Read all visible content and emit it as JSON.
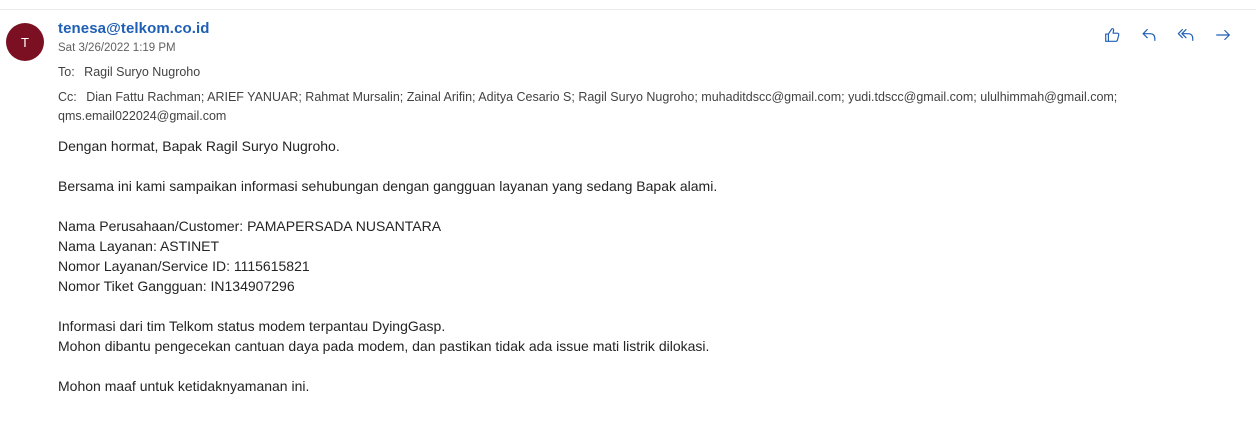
{
  "email": {
    "avatar_initial": "T",
    "sender": "tenesa@telkom.co.id",
    "date": "Sat 3/26/2022 1:19 PM",
    "to_label": "To:",
    "to": "Ragil Suryo Nugroho",
    "cc_label": "Cc:",
    "cc": "Dian Fattu Rachman; ARIEF YANUAR; Rahmat Mursalin; Zainal Arifin; Aditya Cesario S; Ragil Suryo Nugroho; muhaditdscc@gmail.com; yudi.tdscc@gmail.com; ululhimmah@gmail.com; qms.email022024@gmail.com"
  },
  "actions": [
    {
      "icon": "thumbs-up-icon"
    },
    {
      "icon": "reply-icon"
    },
    {
      "icon": "reply-all-icon"
    },
    {
      "icon": "forward-icon"
    }
  ],
  "body": {
    "greeting": "Dengan hormat, Bapak Ragil Suryo Nugroho.",
    "intro": "Bersama ini kami sampaikan informasi sehubungan dengan gangguan layanan yang sedang Bapak alami.",
    "company": "Nama Perusahaan/Customer: PAMAPERSADA NUSANTARA",
    "service_name": "Nama Layanan: ASTINET",
    "service_id": "Nomor Layanan/Service ID: 1115615821",
    "ticket": "Nomor Tiket Gangguan: IN134907296",
    "info_1": "Informasi dari tim Telkom status modem terpantau DyingGasp.",
    "info_2": "Mohon dibantu pengecekan cantuan daya pada modem, dan pastikan tidak ada issue mati listrik dilokasi.",
    "closing": "Mohon maaf untuk ketidaknyamanan ini."
  },
  "colors": {
    "accent": "#1f5fb4",
    "avatar": "#7a1022"
  }
}
